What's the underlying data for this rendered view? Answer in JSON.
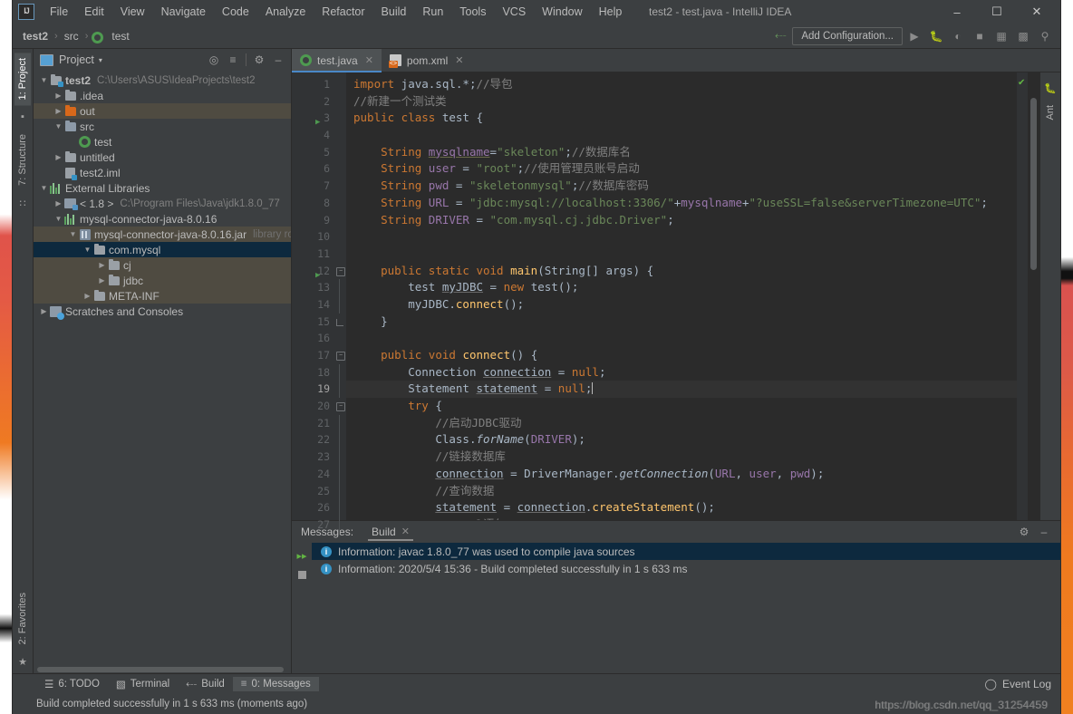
{
  "window": {
    "title": "test2 - test.java - IntelliJ IDEA",
    "logo": "IJ",
    "minimize": "–",
    "maximize": "☐",
    "close": "✕"
  },
  "menu": {
    "items": [
      "File",
      "Edit",
      "View",
      "Navigate",
      "Code",
      "Analyze",
      "Refactor",
      "Build",
      "Run",
      "Tools",
      "VCS",
      "Window",
      "Help"
    ]
  },
  "navbar": {
    "breadcrumb": [
      "test2",
      "src",
      "test"
    ],
    "separator": "›",
    "add_configuration": "Add Configuration...",
    "icons": [
      "build-hammer-icon",
      "run-icon",
      "debug-icon",
      "run-coverage-icon",
      "stop-icon",
      "project-structure-icon",
      "terminal-icon",
      "search-everywhere-icon"
    ]
  },
  "left_strip": {
    "tabs": [
      "1: Project",
      "7: Structure"
    ],
    "bottom_tabs": [
      "2: Favorites"
    ]
  },
  "right_strip": {
    "tabs": [
      "Ant"
    ]
  },
  "project": {
    "title": "Project",
    "caret": "▾",
    "actions": [
      "locate-icon",
      "collapse-all-icon",
      "settings-gear-icon",
      "hide-icon"
    ],
    "tree": [
      {
        "indent": 0,
        "arrow": "▼",
        "icon": "module-folder-icon",
        "label": "test2",
        "bold": true,
        "path": "C:\\Users\\ASUS\\IdeaProjects\\test2",
        "state": "none"
      },
      {
        "indent": 1,
        "arrow": "▶",
        "icon": "folder-icon",
        "label": ".idea",
        "bold": false,
        "path": "",
        "state": "none"
      },
      {
        "indent": 1,
        "arrow": "▶",
        "icon": "folder-orange-icon",
        "label": "out",
        "bold": false,
        "path": "",
        "state": "olive"
      },
      {
        "indent": 1,
        "arrow": "▼",
        "icon": "folder-source-icon",
        "label": "src",
        "bold": false,
        "path": "",
        "state": "none"
      },
      {
        "indent": 2,
        "arrow": "",
        "icon": "java-class-icon",
        "label": "test",
        "bold": false,
        "path": "",
        "state": "none"
      },
      {
        "indent": 1,
        "arrow": "▶",
        "icon": "folder-icon",
        "label": "untitled",
        "bold": false,
        "path": "",
        "state": "none"
      },
      {
        "indent": 1,
        "arrow": "",
        "icon": "iml-file-icon",
        "label": "test2.iml",
        "bold": false,
        "path": "",
        "state": "none"
      },
      {
        "indent": 0,
        "arrow": "▼",
        "icon": "external-libraries-icon",
        "label": "External Libraries",
        "bold": false,
        "path": "",
        "state": "none"
      },
      {
        "indent": 1,
        "arrow": "▶",
        "icon": "jdk-icon",
        "label": "< 1.8 >",
        "bold": false,
        "path": "C:\\Program Files\\Java\\jdk1.8.0_77",
        "state": "none"
      },
      {
        "indent": 1,
        "arrow": "▼",
        "icon": "library-icon",
        "label": "mysql-connector-java-8.0.16",
        "bold": false,
        "path": "",
        "state": "none"
      },
      {
        "indent": 2,
        "arrow": "▼",
        "icon": "jar-icon",
        "label": "mysql-connector-java-8.0.16.jar",
        "bold": false,
        "path": "library root",
        "state": "olive"
      },
      {
        "indent": 3,
        "arrow": "▼",
        "icon": "package-icon",
        "label": "com.mysql",
        "bold": false,
        "path": "",
        "state": "blue"
      },
      {
        "indent": 4,
        "arrow": "▶",
        "icon": "package-icon",
        "label": "cj",
        "bold": false,
        "path": "",
        "state": "olive"
      },
      {
        "indent": 4,
        "arrow": "▶",
        "icon": "package-icon",
        "label": "jdbc",
        "bold": false,
        "path": "",
        "state": "olive"
      },
      {
        "indent": 3,
        "arrow": "▶",
        "icon": "package-icon",
        "label": "META-INF",
        "bold": false,
        "path": "",
        "state": "olive"
      },
      {
        "indent": 0,
        "arrow": "▶",
        "icon": "scratches-icon",
        "label": "Scratches and Consoles",
        "bold": false,
        "path": "",
        "state": "none"
      }
    ]
  },
  "editor": {
    "tabs": [
      {
        "label": "test.java",
        "icon": "java-class-icon",
        "active": true,
        "close": "✕"
      },
      {
        "label": "pom.xml",
        "icon": "xml-file-icon",
        "active": false,
        "close": "✕"
      }
    ],
    "current_line": 19,
    "first_line": 1,
    "lines": [
      {
        "n": 1,
        "runmark": false,
        "fold": "",
        "tokens": [
          {
            "t": "kw",
            "v": "import"
          },
          {
            "t": "txt",
            "v": " java.sql.*;"
          },
          {
            "t": "cmt",
            "v": "//导包"
          }
        ]
      },
      {
        "n": 2,
        "runmark": false,
        "fold": "",
        "tokens": [
          {
            "t": "cmt",
            "v": "//新建一个测试类"
          }
        ]
      },
      {
        "n": 3,
        "runmark": true,
        "fold": "",
        "tokens": [
          {
            "t": "kw",
            "v": "public class"
          },
          {
            "t": "txt",
            "v": " "
          },
          {
            "t": "typ",
            "v": "test"
          },
          {
            "t": "txt",
            "v": " {"
          }
        ]
      },
      {
        "n": 4,
        "runmark": false,
        "fold": "",
        "tokens": []
      },
      {
        "n": 5,
        "runmark": false,
        "fold": "",
        "tokens": [
          {
            "t": "txt",
            "v": "    "
          },
          {
            "t": "kw",
            "v": "String"
          },
          {
            "t": "txt",
            "v": " "
          },
          {
            "t": "fld",
            "v": "mysqlname"
          },
          {
            "t": "txt",
            "v": "="
          },
          {
            "t": "str",
            "v": "\"skeleton\""
          },
          {
            "t": "txt",
            "v": ";"
          },
          {
            "t": "cmt",
            "v": "//数据库名"
          }
        ]
      },
      {
        "n": 6,
        "runmark": false,
        "fold": "",
        "tokens": [
          {
            "t": "txt",
            "v": "    "
          },
          {
            "t": "kw",
            "v": "String"
          },
          {
            "t": "txt",
            "v": " "
          },
          {
            "t": "fld-p",
            "v": "user"
          },
          {
            "t": "txt",
            "v": " = "
          },
          {
            "t": "str",
            "v": "\"root\""
          },
          {
            "t": "txt",
            "v": ";"
          },
          {
            "t": "cmt",
            "v": "//使用管理员账号启动"
          }
        ]
      },
      {
        "n": 7,
        "runmark": false,
        "fold": "",
        "tokens": [
          {
            "t": "txt",
            "v": "    "
          },
          {
            "t": "kw",
            "v": "String"
          },
          {
            "t": "txt",
            "v": " "
          },
          {
            "t": "fld-p",
            "v": "pwd"
          },
          {
            "t": "txt",
            "v": " = "
          },
          {
            "t": "str",
            "v": "\"skeletonmysql\""
          },
          {
            "t": "txt",
            "v": ";"
          },
          {
            "t": "cmt",
            "v": "//数据库密码"
          }
        ]
      },
      {
        "n": 8,
        "runmark": false,
        "fold": "",
        "tokens": [
          {
            "t": "txt",
            "v": "    "
          },
          {
            "t": "kw",
            "v": "String"
          },
          {
            "t": "txt",
            "v": " "
          },
          {
            "t": "fld-p",
            "v": "URL"
          },
          {
            "t": "txt",
            "v": " = "
          },
          {
            "t": "str",
            "v": "\"jdbc:mysql://localhost:3306/\""
          },
          {
            "t": "txt",
            "v": "+"
          },
          {
            "t": "fld-p",
            "v": "mysqlname"
          },
          {
            "t": "txt",
            "v": "+"
          },
          {
            "t": "str",
            "v": "\"?useSSL=false&serverTimezone=UTC\""
          },
          {
            "t": "txt",
            "v": ";"
          }
        ]
      },
      {
        "n": 9,
        "runmark": false,
        "fold": "",
        "tokens": [
          {
            "t": "txt",
            "v": "    "
          },
          {
            "t": "kw",
            "v": "String"
          },
          {
            "t": "txt",
            "v": " "
          },
          {
            "t": "fld-p",
            "v": "DRIVER"
          },
          {
            "t": "txt",
            "v": " = "
          },
          {
            "t": "str",
            "v": "\"com.mysql.cj.jdbc.Driver\""
          },
          {
            "t": "txt",
            "v": ";"
          }
        ]
      },
      {
        "n": 10,
        "runmark": false,
        "fold": "",
        "tokens": []
      },
      {
        "n": 11,
        "runmark": false,
        "fold": "",
        "tokens": []
      },
      {
        "n": 12,
        "runmark": true,
        "fold": "start",
        "tokens": [
          {
            "t": "txt",
            "v": "    "
          },
          {
            "t": "kw",
            "v": "public static void"
          },
          {
            "t": "txt",
            "v": " "
          },
          {
            "t": "mth",
            "v": "main"
          },
          {
            "t": "txt",
            "v": "("
          },
          {
            "t": "typ",
            "v": "String"
          },
          {
            "t": "txt",
            "v": "[] args) {"
          }
        ]
      },
      {
        "n": 13,
        "runmark": false,
        "fold": "bar",
        "tokens": [
          {
            "t": "txt",
            "v": "        "
          },
          {
            "t": "typ",
            "v": "test"
          },
          {
            "t": "txt",
            "v": " "
          },
          {
            "t": "loc",
            "v": "myJDBC"
          },
          {
            "t": "txt",
            "v": " = "
          },
          {
            "t": "kw",
            "v": "new"
          },
          {
            "t": "txt",
            "v": " "
          },
          {
            "t": "typ",
            "v": "test"
          },
          {
            "t": "txt",
            "v": "();"
          }
        ]
      },
      {
        "n": 14,
        "runmark": false,
        "fold": "bar",
        "tokens": [
          {
            "t": "txt",
            "v": "        "
          },
          {
            "t": "txt",
            "v": "myJDBC."
          },
          {
            "t": "mth",
            "v": "connect"
          },
          {
            "t": "txt",
            "v": "();"
          }
        ]
      },
      {
        "n": 15,
        "runmark": false,
        "fold": "end",
        "tokens": [
          {
            "t": "txt",
            "v": "    }"
          }
        ]
      },
      {
        "n": 16,
        "runmark": false,
        "fold": "",
        "tokens": []
      },
      {
        "n": 17,
        "runmark": false,
        "fold": "start",
        "tokens": [
          {
            "t": "txt",
            "v": "    "
          },
          {
            "t": "kw",
            "v": "public void"
          },
          {
            "t": "txt",
            "v": " "
          },
          {
            "t": "mth",
            "v": "connect"
          },
          {
            "t": "txt",
            "v": "() {"
          }
        ]
      },
      {
        "n": 18,
        "runmark": false,
        "fold": "bar",
        "tokens": [
          {
            "t": "txt",
            "v": "        "
          },
          {
            "t": "typ",
            "v": "Connection"
          },
          {
            "t": "txt",
            "v": " "
          },
          {
            "t": "loc",
            "v": "connection"
          },
          {
            "t": "txt",
            "v": " = "
          },
          {
            "t": "kw",
            "v": "null"
          },
          {
            "t": "txt",
            "v": ";"
          }
        ]
      },
      {
        "n": 19,
        "runmark": false,
        "fold": "bar",
        "tokens": [
          {
            "t": "txt",
            "v": "        "
          },
          {
            "t": "typ",
            "v": "Statement"
          },
          {
            "t": "txt",
            "v": " "
          },
          {
            "t": "loc",
            "v": "statement"
          },
          {
            "t": "txt",
            "v": " = "
          },
          {
            "t": "kw",
            "v": "null"
          },
          {
            "t": "txt",
            "v": ";"
          }
        ]
      },
      {
        "n": 20,
        "runmark": false,
        "fold": "start",
        "tokens": [
          {
            "t": "txt",
            "v": "        "
          },
          {
            "t": "kw",
            "v": "try"
          },
          {
            "t": "txt",
            "v": " {"
          }
        ]
      },
      {
        "n": 21,
        "runmark": false,
        "fold": "bar",
        "tokens": [
          {
            "t": "txt",
            "v": "            "
          },
          {
            "t": "cmt",
            "v": "//启动JDBC驱动"
          }
        ]
      },
      {
        "n": 22,
        "runmark": false,
        "fold": "bar",
        "tokens": [
          {
            "t": "txt",
            "v": "            "
          },
          {
            "t": "typ",
            "v": "Class"
          },
          {
            "t": "txt",
            "v": "."
          },
          {
            "t": "stat",
            "v": "forName"
          },
          {
            "t": "txt",
            "v": "("
          },
          {
            "t": "fld-p",
            "v": "DRIVER"
          },
          {
            "t": "txt",
            "v": ");"
          }
        ]
      },
      {
        "n": 23,
        "runmark": false,
        "fold": "bar",
        "tokens": [
          {
            "t": "txt",
            "v": "            "
          },
          {
            "t": "cmt",
            "v": "//链接数据库"
          }
        ]
      },
      {
        "n": 24,
        "runmark": false,
        "fold": "bar",
        "tokens": [
          {
            "t": "txt",
            "v": "            "
          },
          {
            "t": "loc",
            "v": "connection"
          },
          {
            "t": "txt",
            "v": " = "
          },
          {
            "t": "typ",
            "v": "DriverManager"
          },
          {
            "t": "txt",
            "v": "."
          },
          {
            "t": "stat",
            "v": "getConnection"
          },
          {
            "t": "txt",
            "v": "("
          },
          {
            "t": "fld-p",
            "v": "URL"
          },
          {
            "t": "txt",
            "v": ", "
          },
          {
            "t": "fld-p",
            "v": "user"
          },
          {
            "t": "txt",
            "v": ", "
          },
          {
            "t": "fld-p",
            "v": "pwd"
          },
          {
            "t": "txt",
            "v": ");"
          }
        ]
      },
      {
        "n": 25,
        "runmark": false,
        "fold": "bar",
        "tokens": [
          {
            "t": "txt",
            "v": "            "
          },
          {
            "t": "cmt",
            "v": "//查询数据"
          }
        ]
      },
      {
        "n": 26,
        "runmark": false,
        "fold": "bar",
        "tokens": [
          {
            "t": "txt",
            "v": "            "
          },
          {
            "t": "loc",
            "v": "statement"
          },
          {
            "t": "txt",
            "v": " = "
          },
          {
            "t": "loc",
            "v": "connection"
          },
          {
            "t": "txt",
            "v": "."
          },
          {
            "t": "mth",
            "v": "createStatement"
          },
          {
            "t": "txt",
            "v": "();"
          }
        ]
      },
      {
        "n": 27,
        "runmark": false,
        "fold": "bar",
        "tokens": [
          {
            "t": "txt",
            "v": "            "
          },
          {
            "t": "cmt",
            "v": "//mysql语句"
          }
        ]
      }
    ]
  },
  "messages": {
    "label": "Messages:",
    "tab": "Build",
    "tab_close": "✕",
    "actions": [
      "settings-gear-icon",
      "hide-icon"
    ],
    "side_buttons": [
      "rerun-icon",
      "stop-icon"
    ],
    "rows": [
      {
        "icon": "information-icon",
        "text": "Information: javac 1.8.0_77 was used to compile java sources",
        "selected": true
      },
      {
        "icon": "information-icon",
        "text": "Information: 2020/5/4 15:36 - Build completed successfully in 1 s 633 ms",
        "selected": false
      }
    ]
  },
  "toolwindow_bar": {
    "buttons": [
      {
        "label": "6: TODO",
        "icon": "todo-icon",
        "active": false
      },
      {
        "label": "Terminal",
        "icon": "terminal-icon",
        "active": false
      },
      {
        "label": "Build",
        "icon": "build-hammer-icon",
        "active": false
      },
      {
        "label": "0: Messages",
        "icon": "messages-icon",
        "active": true
      }
    ],
    "event_log": "Event Log",
    "event_log_icon": "event-log-icon"
  },
  "statusbar": {
    "text": "Build completed successfully in 1 s 633 ms (moments ago)"
  },
  "watermark": {
    "text": "https://blog.csdn.net/qq_31254459"
  }
}
